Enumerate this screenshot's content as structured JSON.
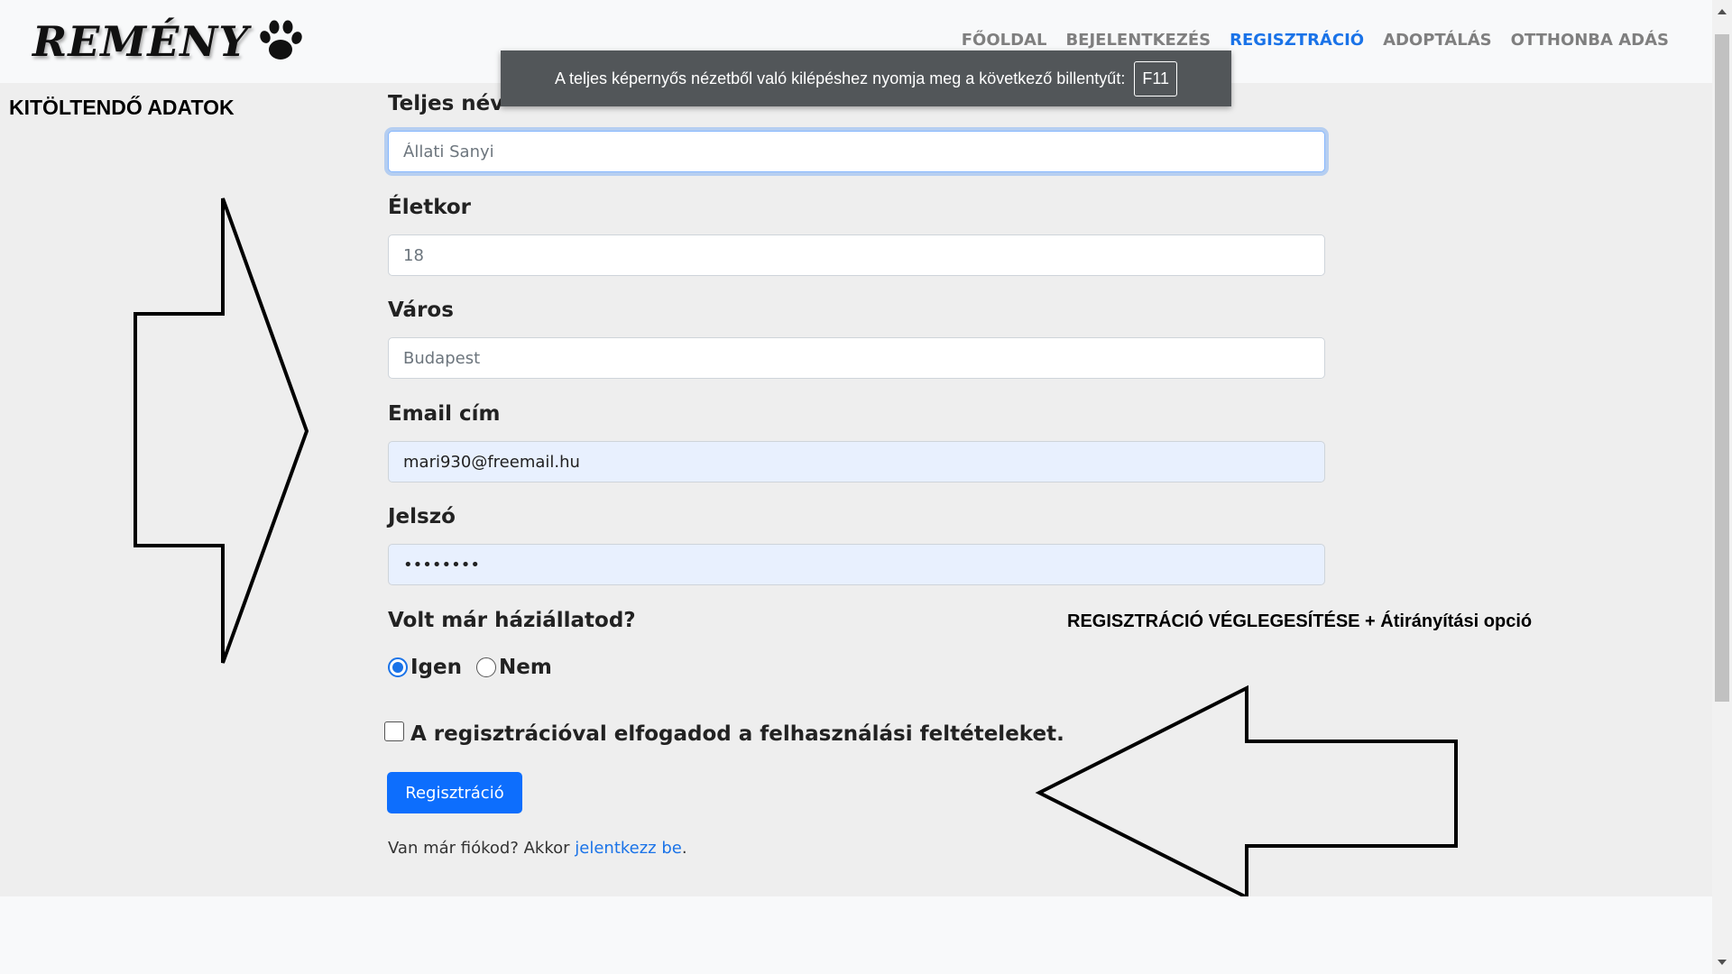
{
  "logo": {
    "text": "REMÉNY",
    "icon": "paw-icon"
  },
  "nav": {
    "items": [
      {
        "label": "FŐOLDAL",
        "active": false
      },
      {
        "label": "BEJELENTKEZÉS",
        "active": false
      },
      {
        "label": "REGISZTRÁCIÓ",
        "active": true
      },
      {
        "label": "ADOPTÁLÁS",
        "active": false
      },
      {
        "label": "OTTHONBA ADÁS",
        "active": false
      }
    ]
  },
  "toast": {
    "message": "A teljes képernyős nézetből való kilépéshez nyomja meg a következő billentyűt:",
    "key": "F11"
  },
  "annotations": {
    "side_title": "KITÖLTENDŐ ADATOK",
    "right_note": "REGISZTRÁCIÓ VÉGLEGESÍTÉSE + Átirányítási opció"
  },
  "form": {
    "name": {
      "label": "Teljes név",
      "placeholder": "Állati Sanyi",
      "value": ""
    },
    "age": {
      "label": "Életkor",
      "placeholder": "18",
      "value": ""
    },
    "city": {
      "label": "Város",
      "placeholder": "Budapest",
      "value": ""
    },
    "email": {
      "label": "Email cím",
      "placeholder": "",
      "value": "mari930@freemail.hu"
    },
    "password": {
      "label": "Jelszó",
      "placeholder": "",
      "value": "12345678"
    },
    "pet_question": "Volt már háziállatod?",
    "pet_yes": "Igen",
    "pet_no": "Nem",
    "pet_selected": "Igen",
    "terms": "A regisztrációval elfogadod a felhasználási feltételeket.",
    "terms_checked": false,
    "submit": "Regisztráció",
    "login_prefix": "Van már fiókod? Akkor ",
    "login_link": "jelentkezz be",
    "login_suffix": "."
  },
  "colors": {
    "accent": "#1a73e8",
    "button": "#0d6efd",
    "background": "#eeeeee",
    "navbar": "#f8f9fa"
  }
}
